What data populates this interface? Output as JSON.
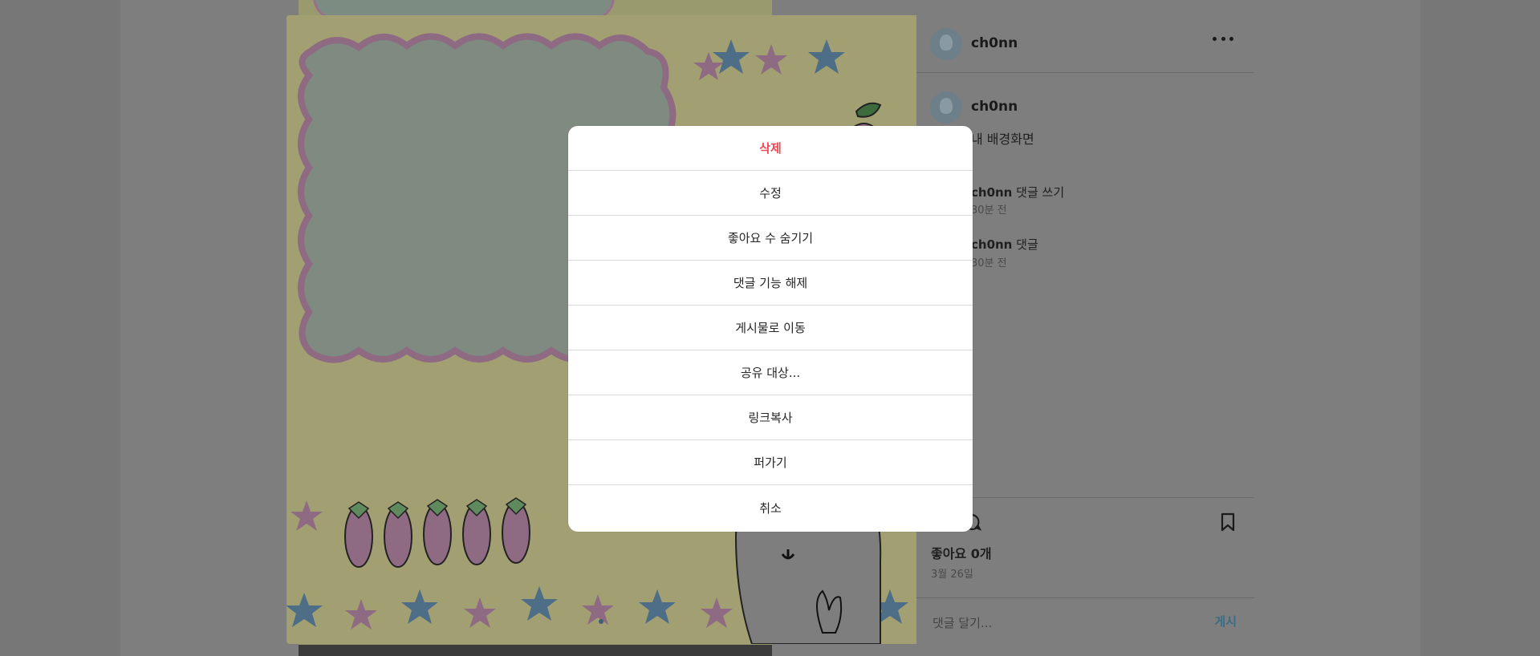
{
  "post": {
    "author": "ch0nn",
    "caption": "내 배경화면",
    "comments": [
      {
        "user": "ch0nn",
        "text": "댓글 쓰기",
        "time": "30분 전"
      },
      {
        "user": "ch0nn",
        "text": "댓글",
        "time": "30분 전"
      }
    ],
    "likes": "좋아요 0개",
    "date": "3월 26일",
    "comment_placeholder": "댓글 달기...",
    "post_label": "게시"
  },
  "options": {
    "delete": "삭제",
    "edit": "수정",
    "hide_likes": "좋아요 수 숨기기",
    "disable_comments": "댓글 기능 해제",
    "go_to_post": "게시물로 이동",
    "share_to": "공유 대상...",
    "copy_link": "링크복사",
    "embed": "퍼가기",
    "cancel": "취소"
  },
  "colors": {
    "danger": "#ed4956",
    "overlay": "#767676",
    "post_link": "#3b6b85"
  },
  "icons": [
    "more-icon",
    "comment-icon",
    "bookmark-icon",
    "star-icon",
    "strawberry-icon",
    "apple-icon",
    "bunny-icon"
  ]
}
